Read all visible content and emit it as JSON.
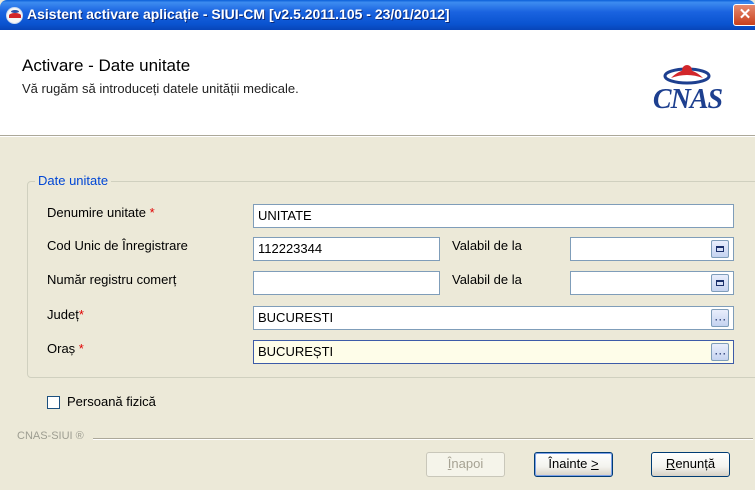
{
  "window": {
    "title": "Asistent activare aplicație - SIUI-CM [v2.5.2011.105 - 23/01/2012]",
    "close_glyph": "✕"
  },
  "header": {
    "title": "Activare - Date unitate",
    "subtitle": "Vă rugăm să introduceți datele unității medicale.",
    "logo_text": "CNAS"
  },
  "group": {
    "title": "Date unitate",
    "fields": {
      "denumire": {
        "label": "Denumire unitate",
        "required_mark": "*",
        "value": "UNITATE"
      },
      "cui": {
        "label": "Cod Unic de Înregistrare",
        "value": "112223344",
        "valid_label": "Valabil de la",
        "valid_value": ""
      },
      "registru": {
        "label": "Număr registru comerț",
        "value": "",
        "valid_label": "Valabil de la",
        "valid_value": ""
      },
      "judet": {
        "label": "Județ",
        "required_mark": "*",
        "value": "BUCURESTI"
      },
      "oras": {
        "label": "Oraș",
        "required_mark": "*",
        "value": "BUCUREȘTI"
      }
    }
  },
  "checkbox": {
    "label": "Persoană fizică",
    "checked": false
  },
  "footer": {
    "mark": "CNAS-SIUI ®"
  },
  "buttons": {
    "back": {
      "pre": "",
      "accel": "Î",
      "post": "napoi",
      "enabled": false
    },
    "next": {
      "pre": "Înainte ",
      "accel": ">",
      "post": "",
      "enabled": true
    },
    "cancel": {
      "pre": "",
      "accel": "R",
      "post": "enunță",
      "enabled": true
    }
  },
  "colors": {
    "titlebar": "#0a53d0",
    "required": "#e00000",
    "group_title": "#0046d5",
    "logo": "#1d3f8f",
    "focused_field_bg": "#fefde9"
  },
  "icons": {
    "app": "cnas-app-icon",
    "calendar": "calendar-icon",
    "browse": "ellipsis-icon"
  }
}
